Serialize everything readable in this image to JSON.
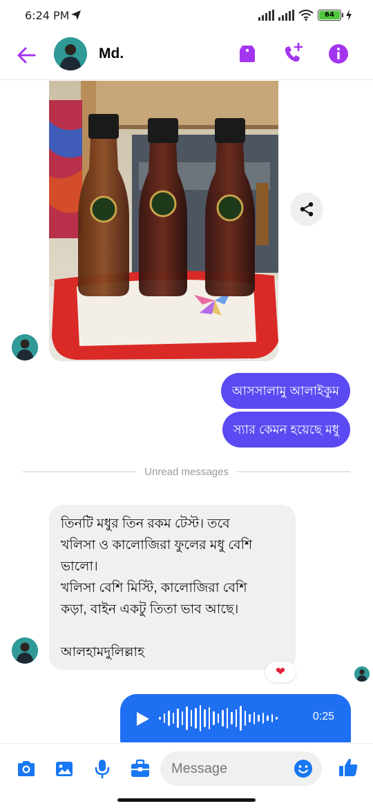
{
  "status_bar": {
    "time": "6:24 PM",
    "battery": "64"
  },
  "header": {
    "contact_name": "Md."
  },
  "messages": {
    "outgoing_1": "আসসালামু আলাইকুম",
    "outgoing_2": "স্যার কেমন হয়েছে মধু",
    "unread_divider": "Unread messages",
    "incoming_lines": [
      "তিনটি মধুর তিন রকম টেস্ট।  তবে",
      "খলিসা ও কালোজিরা ফুলের মধু বেশি",
      "ভালো।",
      "খলিসা বেশি মিস্টি, কালোজিরা বেশি",
      "কড়া, বাইন একটু তিতা ভাব আছে।",
      "",
      "আলহামদুলিল্লাহ"
    ],
    "reaction": "❤",
    "voice_duration": "0:25"
  },
  "composer": {
    "placeholder": "Message"
  },
  "colors": {
    "accent_purple": "#a335f0",
    "outgoing_bubble": "#5b4af2",
    "voice_bubble": "#1f6ff2",
    "composer_blue": "#1877f2"
  }
}
